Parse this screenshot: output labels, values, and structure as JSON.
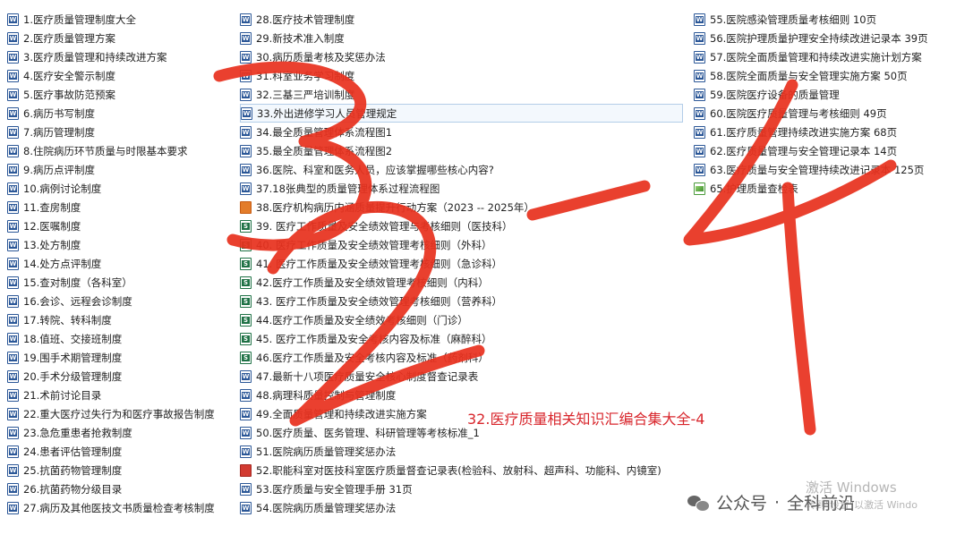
{
  "files": {
    "col1": [
      {
        "name": "1.医疗质量管理制度大全",
        "icon": "word-icon"
      },
      {
        "name": "2.医疗质量管理方案",
        "icon": "word-icon"
      },
      {
        "name": "3.医疗质量管理和持续改进方案",
        "icon": "word-icon"
      },
      {
        "name": "4.医疗安全警示制度",
        "icon": "word-icon"
      },
      {
        "name": "5.医疗事故防范预案",
        "icon": "word-icon"
      },
      {
        "name": "6.病历书写制度",
        "icon": "word-icon"
      },
      {
        "name": "7.病历管理制度",
        "icon": "word-icon"
      },
      {
        "name": "8.住院病历环节质量与时限基本要求",
        "icon": "word-icon"
      },
      {
        "name": "9.病历点评制度",
        "icon": "word-icon"
      },
      {
        "name": "10.病例讨论制度",
        "icon": "word-icon"
      },
      {
        "name": "11.查房制度",
        "icon": "word-icon"
      },
      {
        "name": "12.医嘱制度",
        "icon": "word-icon"
      },
      {
        "name": "13.处方制度",
        "icon": "word-icon"
      },
      {
        "name": "14.处方点评制度",
        "icon": "word-icon"
      },
      {
        "name": "15.查对制度（各科室）",
        "icon": "word-icon"
      },
      {
        "name": "16.会诊、远程会诊制度",
        "icon": "word-icon"
      },
      {
        "name": "17.转院、转科制度",
        "icon": "word-icon"
      },
      {
        "name": "18.值班、交接班制度",
        "icon": "word-icon"
      },
      {
        "name": "19.围手术期管理制度",
        "icon": "word-icon"
      },
      {
        "name": "20.手术分级管理制度",
        "icon": "word-icon"
      },
      {
        "name": "21.术前讨论目录",
        "icon": "word-icon"
      },
      {
        "name": "22.重大医疗过失行为和医疗事故报告制度",
        "icon": "word-icon"
      },
      {
        "name": "23.急危重患者抢救制度",
        "icon": "word-icon"
      },
      {
        "name": "24.患者评估管理制度",
        "icon": "word-icon"
      },
      {
        "name": "25.抗菌药物管理制度",
        "icon": "word-icon"
      },
      {
        "name": "26.抗菌药物分级目录",
        "icon": "word-icon"
      },
      {
        "name": "27.病历及其他医技文书质量检查考核制度",
        "icon": "word-icon"
      }
    ],
    "col2": [
      {
        "name": "28.医疗技术管理制度",
        "icon": "word-icon"
      },
      {
        "name": "29.新技术准入制度",
        "icon": "word-icon"
      },
      {
        "name": "30.病历质量考核及奖惩办法",
        "icon": "word-icon"
      },
      {
        "name": "31.科室业务学习制度",
        "icon": "word-icon"
      },
      {
        "name": "32.三基三严培训制度",
        "icon": "word-icon"
      },
      {
        "name": "33.外出进修学习人员管理规定",
        "icon": "word-icon"
      },
      {
        "name": "34.最全质量管理体系流程图1",
        "icon": "word-icon"
      },
      {
        "name": "35.最全质量管理体系流程图2",
        "icon": "word-icon"
      },
      {
        "name": "36.医院、科室和医务人员，应该掌握哪些核心内容?",
        "icon": "word-icon"
      },
      {
        "name": "37.18张典型的质量管理体系过程流程图",
        "icon": "word-icon"
      },
      {
        "name": "38.医疗机构病历内涵质量提升行动方案（2023 -- 2025年）",
        "icon": "ppt-icon"
      },
      {
        "name": "39. 医疗工作质量及安全绩效管理与考核细则（医技科）",
        "icon": "excel-icon"
      },
      {
        "name": "40.  医疗工作质量及安全绩效管理考核细则（外科）",
        "icon": "excel-icon"
      },
      {
        "name": "41. 医疗工作质量及安全绩效管理考核细则（急诊科）",
        "icon": "excel-icon"
      },
      {
        "name": "42.医疗工作质量及安全绩效管理考核细则（内科）",
        "icon": "excel-icon"
      },
      {
        "name": "43. 医疗工作质量及安全绩效管理考核细则（营养科）",
        "icon": "excel-icon"
      },
      {
        "name": "44.医疗工作质量及安全绩效考核细则（门诊）",
        "icon": "excel-icon"
      },
      {
        "name": "45.  医疗工作质量及安全考核内容及标准（麻醉科）",
        "icon": "excel-icon"
      },
      {
        "name": "46.医疗工作质量及安全考核内容及标准（药剂科）",
        "icon": "excel-icon"
      },
      {
        "name": "47.最新十八项医疗质量安全核心制度督查记录表",
        "icon": "word-icon"
      },
      {
        "name": "48.病理科质量控制与管理制度",
        "icon": "word-icon"
      },
      {
        "name": "49.全面质量管理和持续改进实施方案",
        "icon": "word-icon"
      },
      {
        "name": "50.医疗质量、医务管理、科研管理等考核标准_1",
        "icon": "word-icon"
      },
      {
        "name": "51.医院病历质量管理奖惩办法",
        "icon": "word-icon"
      },
      {
        "name": "52.职能科室对医技科室医疗质量督查记录表(检验科、放射科、超声科、功能科、内镜室)",
        "icon": "pdf-icon"
      },
      {
        "name": "53.医疗质量与安全管理手册   31页",
        "icon": "word-icon"
      },
      {
        "name": "54.医院病历质量管理奖惩办法",
        "icon": "word-icon"
      }
    ],
    "col3": [
      {
        "name": "55.医院感染管理质量考核细则   10页",
        "icon": "word-icon"
      },
      {
        "name": "56.医院护理质量护理安全持续改进记录本   39页",
        "icon": "word-icon"
      },
      {
        "name": "57.医院全面质量管理和持续改进实施计划方案",
        "icon": "word-icon"
      },
      {
        "name": "58.医院全面质量与安全管理实施方案   50页",
        "icon": "word-icon"
      },
      {
        "name": "59.医院医疗设备的质量管理",
        "icon": "word-icon"
      },
      {
        "name": "60.医院医疗质量管理与考核细则   49页",
        "icon": "word-icon"
      },
      {
        "name": "61.医疗质量管理持续改进实施方案   68页",
        "icon": "word-icon"
      },
      {
        "name": "62.医疗质量管理与安全管理记录本   14页",
        "icon": "word-icon"
      },
      {
        "name": "63.医疗质量与安全管理持续改进记录本   125页",
        "icon": "word-icon"
      },
      {
        "name": "65.护理质量查检表",
        "icon": "image-icon"
      }
    ]
  },
  "selected_file": "33.外出进修学习人员管理规定",
  "caption": "32.医疗质量相关知识汇编合集大全-4",
  "scribble_color": "#e8321f",
  "watermark": {
    "icon": "wechat-icon",
    "label": "公众号",
    "separator": "·",
    "account": "全科前沿"
  },
  "activate": {
    "line1": "激活 Windows",
    "line2": "转到\"设置\"以激活 Windo"
  }
}
